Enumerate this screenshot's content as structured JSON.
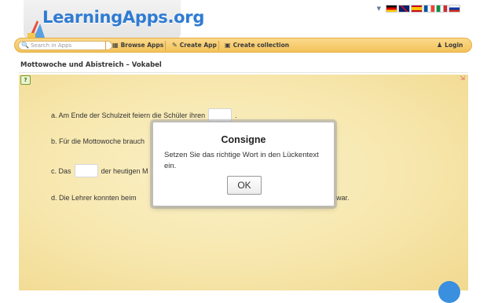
{
  "header": {
    "logo_text": "LearningApps.org",
    "language_flags": [
      "de-flag-icon",
      "uk-flag-icon",
      "es-flag-icon",
      "fr-flag-icon",
      "it-flag-icon",
      "ru-flag-icon"
    ]
  },
  "navbar": {
    "search_placeholder": "Search in Apps",
    "browse_label": "Browse Apps",
    "create_app_label": "Create App",
    "create_collection_label": "Create collection",
    "login_label": "Login"
  },
  "page": {
    "title": "Mottowoche und Abistreich – Vokabel"
  },
  "exercise": {
    "lines": [
      {
        "before": "a. Am Ende der Schulzeit feiern die Schüler ihren",
        "after": "."
      },
      {
        "before": "b. Für die Mottowoche brauch",
        "after": ""
      },
      {
        "before": "c. Das",
        "after": "der heutigen M"
      },
      {
        "before": "d. Die Lehrer konnten beim",
        "after": "war."
      }
    ]
  },
  "dialog": {
    "title": "Consigne",
    "text": "Setzen Sie das richtige Wort in den Lückentext ein.",
    "ok_label": "OK"
  },
  "colors": {
    "navbar": "#f3c35a",
    "logo_text": "#2f7bd2",
    "stage": "#f7e7ad",
    "fab": "#3a8fdf"
  }
}
